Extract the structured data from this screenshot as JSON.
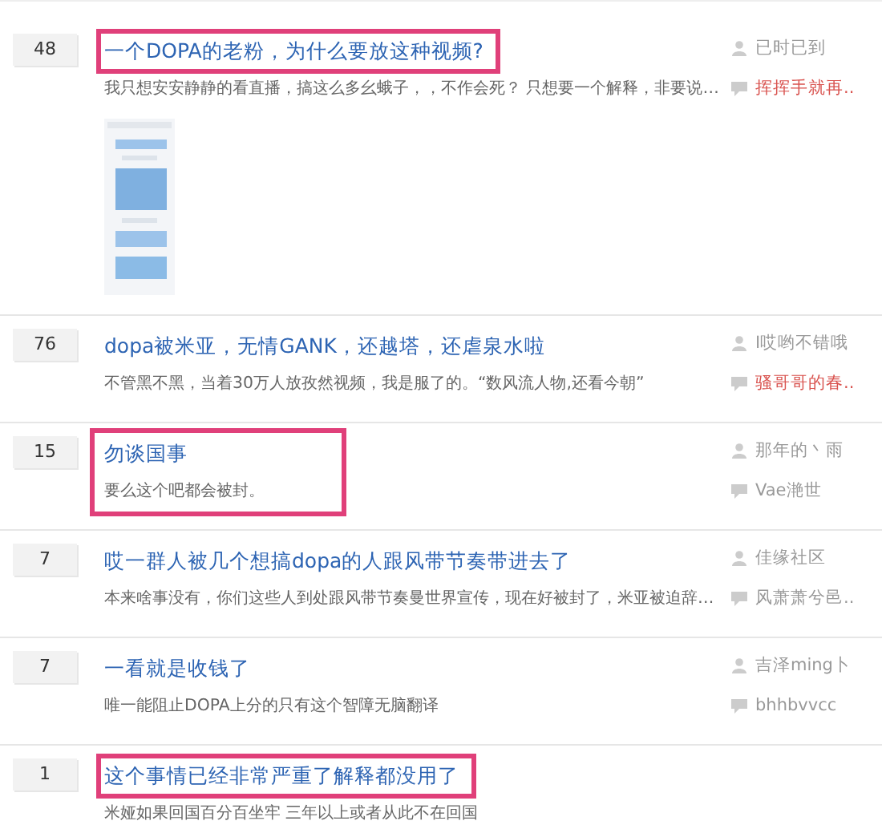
{
  "threads": [
    {
      "replies": "48",
      "title": "一个DOPA的老粉，为什么要放这种视频?",
      "excerpt": "我只想安安静静的看直播，搞这么多幺蛾子，，不作会死？ 只想要一个解释，非要说…",
      "title_highlighted": true,
      "post_highlighted": false,
      "author": "已时已到",
      "last_reply": {
        "name": "挥挥手就再..",
        "color": "#d9534f"
      }
    },
    {
      "replies": "76",
      "title": "dopa被米亚，无情GANK，还越塔，还虐泉水啦",
      "excerpt": "不管黑不黑，当着30万人放孜然视频，我是服了的。“数风流人物,还看今朝”",
      "title_highlighted": false,
      "post_highlighted": false,
      "author": "I哎哟不错哦",
      "last_reply": {
        "name": "骚哥哥的春..",
        "color": "#d9534f"
      }
    },
    {
      "replies": "15",
      "title": "勿谈国事",
      "excerpt": "要么这个吧都会被封。",
      "title_highlighted": false,
      "post_highlighted": true,
      "author": "那年的丶雨",
      "last_reply": {
        "name": "Vae滟世",
        "color": "#999999"
      }
    },
    {
      "replies": "7",
      "title": "哎一群人被几个想搞dopa的人跟风带节奏带进去了",
      "excerpt": "本来啥事没有，你们这些人到处跟风带节奏曼世界宣传，现在好被封了，米亚被迫辞…",
      "title_highlighted": false,
      "post_highlighted": false,
      "author": "佳缘社区",
      "last_reply": {
        "name": "风萧萧兮邑..",
        "color": "#999999"
      }
    },
    {
      "replies": "7",
      "title": "一看就是收钱了",
      "excerpt": "唯一能阻止DOPA上分的只有这个智障无脑翻译",
      "title_highlighted": false,
      "post_highlighted": false,
      "author": "吉泽ming卜",
      "last_reply": {
        "name": "bhhbvvcc",
        "color": "#999999"
      }
    },
    {
      "replies": "1",
      "title": "这个事情已经非常严重了解释都没用了",
      "excerpt": "米娅如果回国百分百坐牢 三年以上或者从此不在回国",
      "title_highlighted": true,
      "post_highlighted": false
    }
  ]
}
